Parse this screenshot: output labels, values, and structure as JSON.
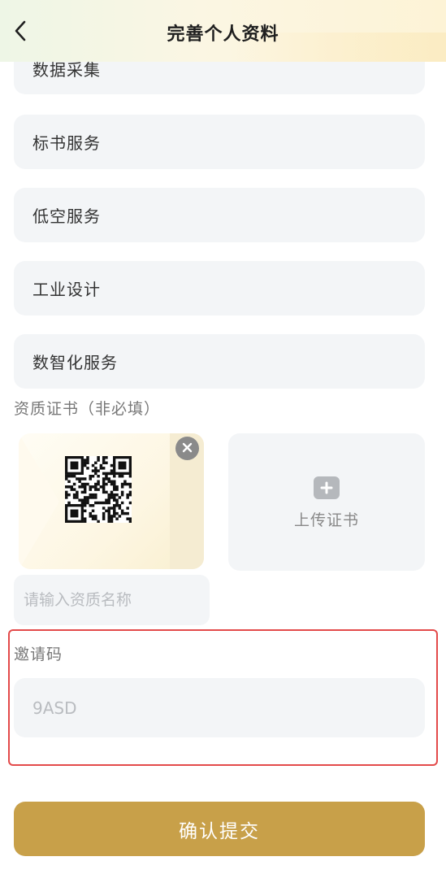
{
  "header": {
    "title": "完善个人资料",
    "back_icon": "chevron-left-icon"
  },
  "categories": [
    {
      "label": "数据采集"
    },
    {
      "label": "标书服务"
    },
    {
      "label": "低空服务"
    },
    {
      "label": "工业设计"
    },
    {
      "label": "数智化服务"
    }
  ],
  "certificate": {
    "section_label": "资质证书（非必填）",
    "remove_icon": "close-icon",
    "upload_icon": "plus-icon",
    "upload_label": "上传证书",
    "name_placeholder": "请输入资质名称",
    "name_value": ""
  },
  "invite": {
    "label": "邀请码",
    "placeholder": "9ASD",
    "value": ""
  },
  "submit": {
    "label": "确认提交"
  },
  "colors": {
    "accent": "#c8a049",
    "highlight_border": "#e34a4a",
    "field_bg": "#f3f5f7"
  }
}
